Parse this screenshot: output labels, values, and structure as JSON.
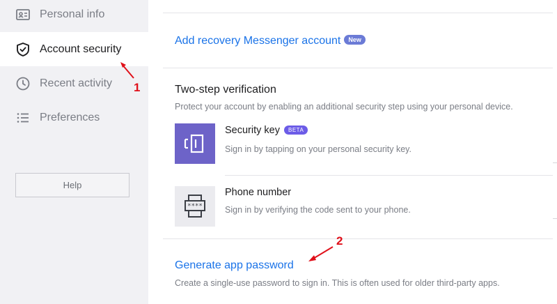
{
  "sidebar": {
    "items": [
      {
        "label": "Personal info",
        "icon": "id-card-icon"
      },
      {
        "label": "Account security",
        "icon": "shield-check-icon",
        "active": true
      },
      {
        "label": "Recent activity",
        "icon": "clock-icon"
      },
      {
        "label": "Preferences",
        "icon": "list-icon"
      }
    ],
    "help_label": "Help"
  },
  "main": {
    "recovery_link": "Add recovery Messenger account",
    "recovery_badge": "New",
    "two_step": {
      "title": "Two-step verification",
      "description": "Protect your account by enabling an additional security step using your personal device.",
      "methods": [
        {
          "title": "Security key",
          "badge": "BETA",
          "description": "Sign in by tapping on your personal security key.",
          "icon": "security-key-icon"
        },
        {
          "title": "Phone number",
          "description": "Sign in by verifying the code sent to your phone.",
          "icon": "phone-password-icon"
        }
      ]
    },
    "app_password": {
      "link": "Generate app password",
      "description": "Create a single-use password to sign in. This is often used for older third-party apps."
    }
  },
  "annotations": {
    "first": "1",
    "second": "2"
  },
  "colors": {
    "link": "#1a73e8",
    "annotation": "#e0101a",
    "tile_purple": "#6d63c8",
    "sidebar_bg": "#f1f1f4"
  }
}
